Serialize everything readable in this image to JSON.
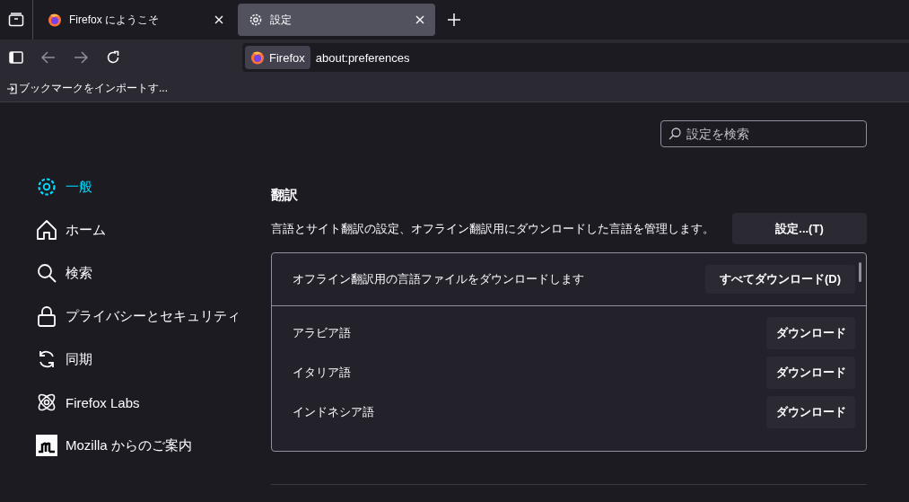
{
  "tabs": [
    {
      "label": "Firefox にようこそ",
      "selected": false,
      "kind": "firefox"
    },
    {
      "label": "設定",
      "selected": true,
      "kind": "gear"
    }
  ],
  "address_bar": {
    "identity": "Firefox",
    "url": "about:preferences"
  },
  "bookmarks_bar": {
    "item": "ブックマークをインポートす..."
  },
  "search": {
    "placeholder": "設定を検索"
  },
  "sidebar": {
    "items": [
      {
        "label": "一般",
        "selected": true
      },
      {
        "label": "ホーム",
        "selected": false
      },
      {
        "label": "検索",
        "selected": false
      },
      {
        "label": "プライバシーとセキュリティ",
        "selected": false
      },
      {
        "label": "同期",
        "selected": false
      },
      {
        "label": "Firefox Labs",
        "selected": false
      },
      {
        "label": "Mozilla からのご案内",
        "selected": false
      }
    ]
  },
  "translation": {
    "heading": "翻訳",
    "description": "言語とサイト翻訳の設定、オフライン翻訳用にダウンロードした言語を管理します。",
    "settings_button": "設定...(T)",
    "download_all_label": "オフライン翻訳用の言語ファイルをダウンロードします",
    "download_all_button": "すべてダウンロード(D)",
    "languages": [
      {
        "name": "アラビア語",
        "button": "ダウンロード"
      },
      {
        "name": "イタリア語",
        "button": "ダウンロード"
      },
      {
        "name": "インドネシア語",
        "button": "ダウンロード"
      }
    ]
  }
}
